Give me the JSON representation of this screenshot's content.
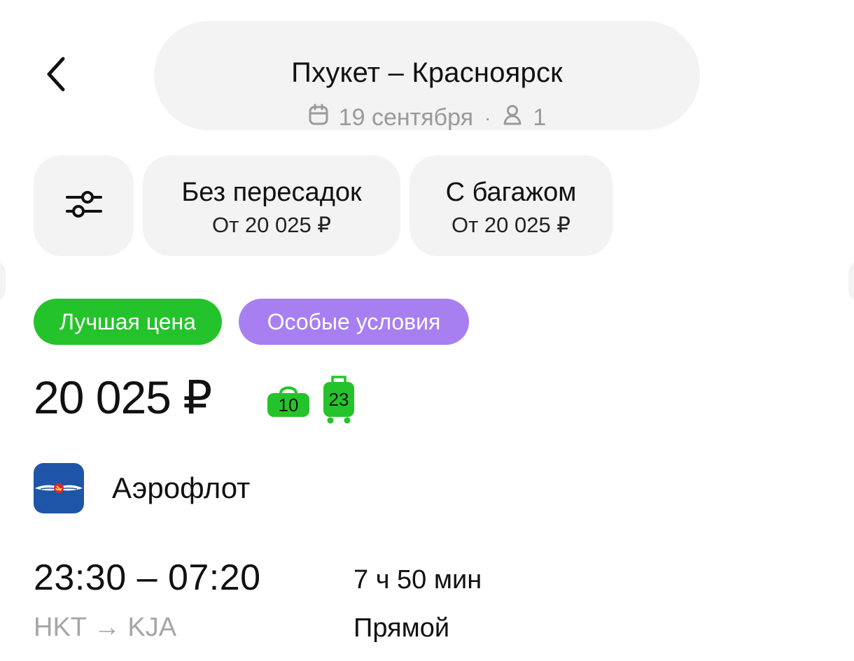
{
  "header": {
    "route": "Пхукет – Красноярск",
    "date": "19 сентября",
    "separator": "·",
    "passengers": "1"
  },
  "filters": {
    "direct": {
      "title": "Без пересадок",
      "price": "От 20 025 ₽"
    },
    "baggage": {
      "title": "С багажом",
      "price": "От 20 025 ₽"
    }
  },
  "badges": {
    "best_price": "Лучшая цена",
    "special_conditions": "Особые условия"
  },
  "offer": {
    "price": "20 025 ₽",
    "hand_luggage_kg": "10",
    "checked_baggage_kg": "23",
    "airline": "Аэрофлот",
    "times": "23:30 – 07:20",
    "route_codes": "HKT → KJA",
    "duration": "7 ч 50 мин",
    "transfer": "Прямой"
  },
  "icons": {
    "back": "chevron-left-icon",
    "calendar": "calendar-icon",
    "passenger": "person-icon",
    "filters": "sliders-icon",
    "hand_luggage": "hand-luggage-icon",
    "checked_baggage": "suitcase-icon",
    "airline_logo": "aeroflot-logo"
  },
  "colors": {
    "best_price_badge": "#25c32b",
    "special_badge": "#a87ff0",
    "baggage_icon": "#25c32b",
    "airline_logo_bg": "#1f55a8",
    "chip_bg": "#f3f3f3"
  }
}
